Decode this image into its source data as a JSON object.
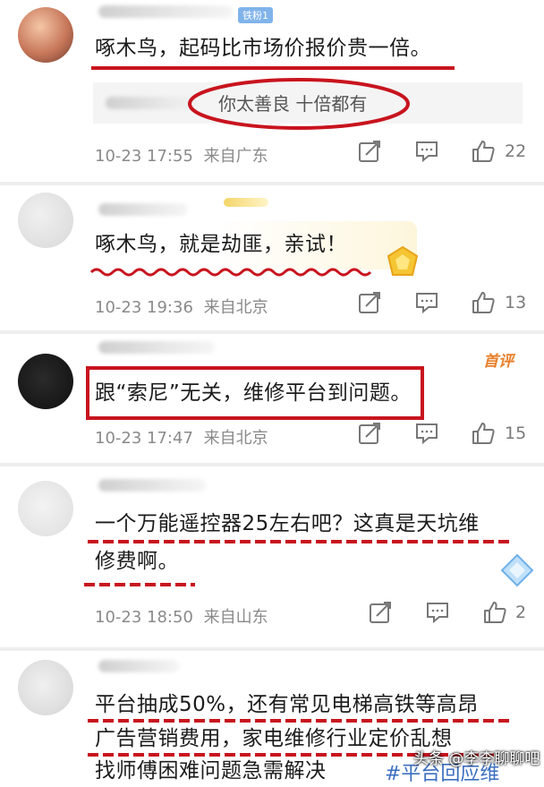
{
  "comments": [
    {
      "badge": "铁粉1",
      "text": "啄木鸟，起码比市场价报价贵一倍。",
      "reply": "你太善良 十倍都有",
      "time": "10-23 17:55",
      "location": "来自广东",
      "likes": "22"
    },
    {
      "text": "啄木鸟，就是劫匪，亲试！",
      "time": "10-23 19:36",
      "location": "来自北京",
      "likes": "13"
    },
    {
      "tag": "首评",
      "text": "跟“索尼”无关，维修平台到问题。",
      "time": "10-23 17:47",
      "location": "来自北京",
      "likes": "15"
    },
    {
      "text_line1": "一个万能遥控器25左右吧？这真是天坑维",
      "text_line2": "修费啊。",
      "time": "10-23 18:50",
      "location": "来自山东",
      "likes": "2"
    },
    {
      "text_line1": "平台抽成50%，还有常见电梯高铁等高昂",
      "text_line2": "广告营销费用，家电维修行业定价乱想",
      "text_line3": "找师傅困难问题急需解决",
      "hashtag": "#平台回应维"
    }
  ],
  "watermark": "头条 @李李聊聊吧",
  "icons": [
    "share-icon",
    "comment-icon",
    "like-icon"
  ],
  "colors": {
    "annotation_red": "#c8141e",
    "meta_gray": "#8a8a8a",
    "badge_blue": "#7fb3ea",
    "first_comment_orange": "#e8802a"
  }
}
